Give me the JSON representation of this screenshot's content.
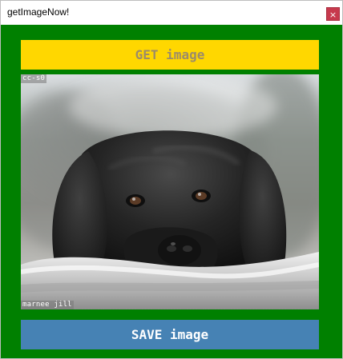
{
  "window": {
    "title": "getImageNow!",
    "close_label": "×"
  },
  "buttons": {
    "get_label": "GET image",
    "save_label": "SAVE image"
  },
  "photo": {
    "license_text": "cc-s0",
    "author_text": "marnee jill"
  },
  "colors": {
    "background": "#008000",
    "get_button": "#ffd700",
    "get_text": "#9b8b6a",
    "save_button": "#4682b4",
    "save_text": "#ffffff",
    "close_button": "#c7394d"
  }
}
